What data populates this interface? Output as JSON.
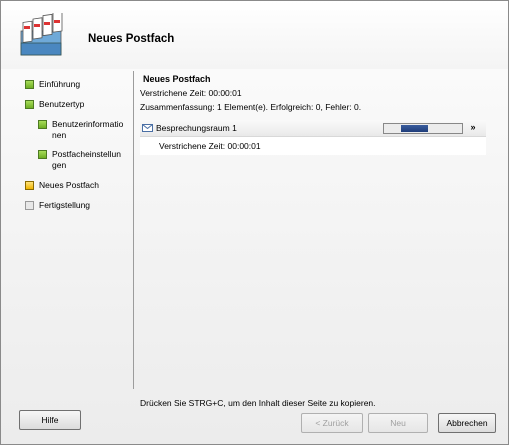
{
  "window": {
    "title": "Neues Postfach"
  },
  "nav": {
    "items": [
      {
        "label": "Einführung",
        "state": "done"
      },
      {
        "label": "Benutzertyp",
        "state": "done"
      },
      {
        "label": "Benutzerinformationen",
        "line1": "Benutzerinformatio",
        "line2": "nen",
        "state": "done"
      },
      {
        "label": "Postfacheinstellungen",
        "line1": "Postfacheinstellun",
        "line2": "gen",
        "state": "done"
      },
      {
        "label": "Neues Postfach",
        "state": "current"
      },
      {
        "label": "Fertigstellung",
        "state": "pending"
      }
    ]
  },
  "content": {
    "title": "Neues Postfach",
    "elapsed": "Verstrichene Zeit: 00:00:01",
    "summary": "Zusammenfassung: 1 Element(e). Erfolgreich: 0, Fehler: 0.",
    "task": {
      "name": "Besprechungsraum 1",
      "detail": "Verstrichene Zeit: 00:00:01",
      "progress_fraction": 0.35,
      "collapse_glyph": "»"
    }
  },
  "footer": {
    "hint": "Drücken Sie STRG+C, um den Inhalt dieser Seite zu kopieren.",
    "help_label": "Hilfe",
    "back_label": "< Zurück",
    "next_label": "Neu",
    "cancel_label": "Abbrechen"
  },
  "colors": {
    "accent": "#2a4a8a",
    "step_done": "#7ab530",
    "step_current": "#f0b400"
  }
}
